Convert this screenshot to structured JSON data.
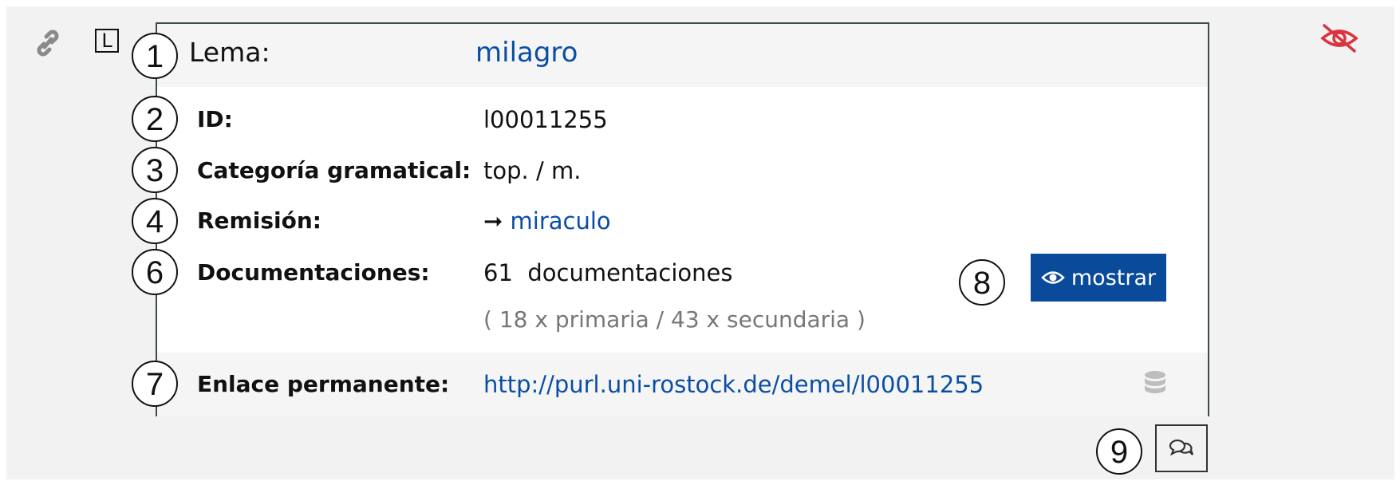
{
  "entry": {
    "lemma_label": "Lema:",
    "lemma_value": "milagro",
    "markers": {
      "L": "L"
    },
    "fields": {
      "id_label": "ID:",
      "id_value": "l00011255",
      "category_label": "Categoría gramatical:",
      "category_value": "top. / m.",
      "remision_label": "Remisión:",
      "remision_arrow": "➞",
      "remision_value": "miraculo",
      "doc_label": "Documentaciones:",
      "doc_count": "61",
      "doc_unit": "documentaciones",
      "doc_breakdown": "( 18 x primaria / 43 x secundaria  )",
      "perm_label": "Enlace permanente:",
      "perm_value": "http://purl.uni-rostock.de/demel/l00011255"
    },
    "show_button": {
      "label": "mostrar",
      "icon": "eye-icon"
    }
  },
  "annotations": [
    "1",
    "2",
    "3",
    "4",
    "6",
    "7",
    "8",
    "9"
  ],
  "icons": {
    "permalink": "link-icon",
    "database": "database-icon",
    "visibility": "eye-off-icon",
    "comments": "comments-icon"
  },
  "colors": {
    "link": "#0a4ea6",
    "button_bg": "#0a4a9a",
    "eye_off": "#d9343f",
    "background": "#f2f2f2"
  }
}
